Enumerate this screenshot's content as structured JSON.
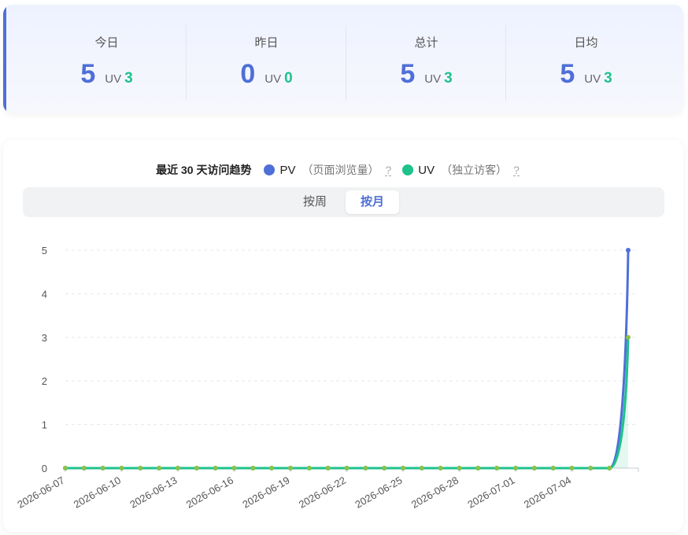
{
  "stats": [
    {
      "label": "今日",
      "pv": "5",
      "uv_label": "UV",
      "uv": "3"
    },
    {
      "label": "昨日",
      "pv": "0",
      "uv_label": "UV",
      "uv": "0"
    },
    {
      "label": "总计",
      "pv": "5",
      "uv_label": "UV",
      "uv": "3"
    },
    {
      "label": "日均",
      "pv": "5",
      "uv_label": "UV",
      "uv": "3"
    }
  ],
  "legend": {
    "title": "最近 30 天访问趋势",
    "pv_name": "PV",
    "pv_desc": "（页面浏览量）",
    "uv_name": "UV",
    "uv_desc": "（独立访客）",
    "help": "?"
  },
  "tabs": {
    "week": "按周",
    "month": "按月",
    "active": "month"
  },
  "colors": {
    "pv": "#4f6fd8",
    "uv": "#1ec28b",
    "accent": "#4f6fd8"
  },
  "chart_data": {
    "type": "line",
    "x": [
      "2026-06-07",
      "2026-06-08",
      "2026-06-09",
      "2026-06-10",
      "2026-06-11",
      "2026-06-12",
      "2026-06-13",
      "2026-06-14",
      "2026-06-15",
      "2026-06-16",
      "2026-06-17",
      "2026-06-18",
      "2026-06-19",
      "2026-06-20",
      "2026-06-21",
      "2026-06-22",
      "2026-06-23",
      "2026-06-24",
      "2026-06-25",
      "2026-06-26",
      "2026-06-27",
      "2026-06-28",
      "2026-06-29",
      "2026-06-30",
      "2026-07-01",
      "2026-07-02",
      "2026-07-03",
      "2026-07-04",
      "2026-07-05",
      "2026-07-06",
      "2026-07-07"
    ],
    "x_tick_labels": [
      "2026-06-07",
      "2026-06-10",
      "2026-06-13",
      "2026-06-16",
      "2026-06-19",
      "2026-06-22",
      "2026-06-25",
      "2026-06-28",
      "2026-07-01",
      "2026-07-04"
    ],
    "series": [
      {
        "name": "PV",
        "values": [
          0,
          0,
          0,
          0,
          0,
          0,
          0,
          0,
          0,
          0,
          0,
          0,
          0,
          0,
          0,
          0,
          0,
          0,
          0,
          0,
          0,
          0,
          0,
          0,
          0,
          0,
          0,
          0,
          0,
          0,
          5
        ]
      },
      {
        "name": "UV",
        "values": [
          0,
          0,
          0,
          0,
          0,
          0,
          0,
          0,
          0,
          0,
          0,
          0,
          0,
          0,
          0,
          0,
          0,
          0,
          0,
          0,
          0,
          0,
          0,
          0,
          0,
          0,
          0,
          0,
          0,
          0,
          3
        ]
      }
    ],
    "y_ticks": [
      "0",
      "1",
      "2",
      "3",
      "4",
      "5"
    ],
    "ylim": [
      0,
      5
    ],
    "grid": true
  }
}
